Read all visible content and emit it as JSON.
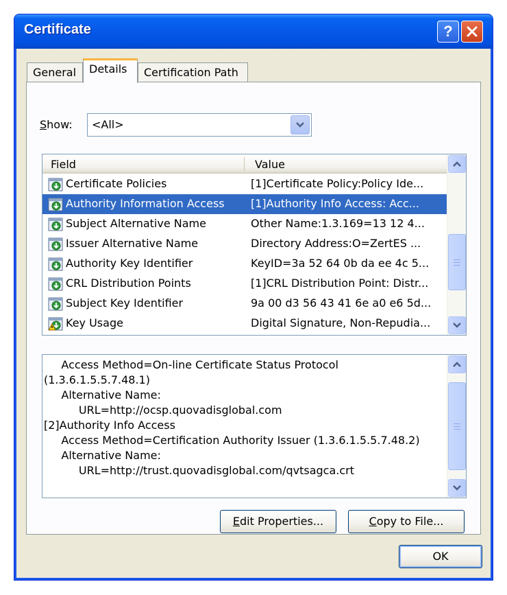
{
  "window": {
    "title": "Certificate",
    "help_label": "?",
    "close_label": "close"
  },
  "tabs": [
    {
      "label": "General"
    },
    {
      "label": "Details",
      "selected": true
    },
    {
      "label": "Certification Path"
    }
  ],
  "show": {
    "label_accel": "S",
    "label_rest": "how:",
    "value": "<All>"
  },
  "list": {
    "columns": {
      "field": "Field",
      "value": "Value"
    },
    "rows": [
      {
        "field": "Certificate Policies",
        "value": "[1]Certificate Policy:Policy Ide...",
        "icon": "extension-icon"
      },
      {
        "field": "Authority Information Access",
        "value": "[1]Authority Info Access: Acc...",
        "icon": "extension-icon",
        "selected": true
      },
      {
        "field": "Subject Alternative Name",
        "value": "Other Name:1.3.169=13 12 4...",
        "icon": "extension-icon"
      },
      {
        "field": "Issuer Alternative Name",
        "value": "Directory Address:O=ZertES ...",
        "icon": "extension-icon"
      },
      {
        "field": "Authority Key Identifier",
        "value": "KeyID=3a 52 64 0b da ee 4c 5...",
        "icon": "extension-icon"
      },
      {
        "field": "CRL Distribution Points",
        "value": "[1]CRL Distribution Point: Distr...",
        "icon": "extension-icon"
      },
      {
        "field": "Subject Key Identifier",
        "value": "9a 00 d3 56 43 41 6e a0 e6 5d...",
        "icon": "extension-icon"
      },
      {
        "field": "Key Usage",
        "value": "Digital Signature, Non-Repudia...",
        "icon": "critical-extension-icon"
      }
    ]
  },
  "detail": {
    "lines": [
      "     Access Method=On-line Certificate Status Protocol",
      "(1.3.6.1.5.5.7.48.1)",
      "     Alternative Name:",
      "          URL=http://ocsp.quovadisglobal.com",
      "[2]Authority Info Access",
      "     Access Method=Certification Authority Issuer (1.3.6.1.5.5.7.48.2)",
      "     Alternative Name:",
      "          URL=http://trust.quovadisglobal.com/qvtsagca.crt"
    ]
  },
  "buttons": {
    "edit_accel": "E",
    "edit_rest": "dit Properties...",
    "copy_accel": "C",
    "copy_rest": "opy to File...",
    "ok": "OK"
  },
  "colors": {
    "titlebar": "#0558e8",
    "selection": "#316ac5",
    "dialog_bg": "#ece9d8"
  }
}
